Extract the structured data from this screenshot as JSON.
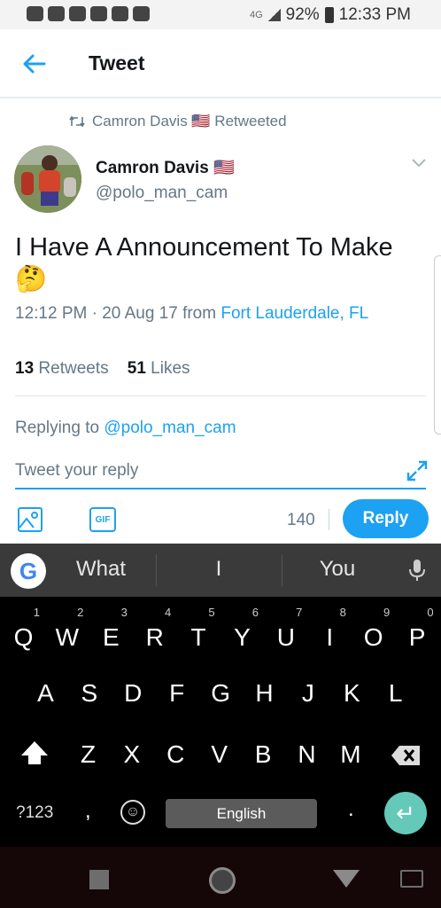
{
  "status_bar": {
    "battery": "92%",
    "time": "12:33 PM",
    "network": "4G"
  },
  "header": {
    "title": "Tweet"
  },
  "tweet": {
    "retweeted_by": "Camron Davis 🇺🇸 Retweeted",
    "author_name": "Camron Davis 🇺🇸",
    "author_handle": "@polo_man_cam",
    "text": "I Have A Announcement To Make 🤔",
    "time": "12:12 PM · 20 Aug 17",
    "from_label": "from",
    "location": "Fort Lauderdale, FL",
    "retweets_count": "13",
    "retweets_label": "Retweets",
    "likes_count": "51",
    "likes_label": "Likes"
  },
  "reply": {
    "replying_to_label": "Replying to",
    "replying_to_handle": "@polo_man_cam",
    "placeholder": "Tweet your reply",
    "gif_label": "GIF",
    "char_count": "140",
    "button_label": "Reply"
  },
  "keyboard": {
    "suggestions": [
      "What",
      "I",
      "You"
    ],
    "row1": [
      {
        "key": "Q",
        "num": "1"
      },
      {
        "key": "W",
        "num": "2"
      },
      {
        "key": "E",
        "num": "3"
      },
      {
        "key": "R",
        "num": "4"
      },
      {
        "key": "T",
        "num": "5"
      },
      {
        "key": "Y",
        "num": "6"
      },
      {
        "key": "U",
        "num": "7"
      },
      {
        "key": "I",
        "num": "8"
      },
      {
        "key": "O",
        "num": "9"
      },
      {
        "key": "P",
        "num": "0"
      }
    ],
    "row2": [
      "A",
      "S",
      "D",
      "F",
      "G",
      "H",
      "J",
      "K",
      "L"
    ],
    "row3": [
      "Z",
      "X",
      "C",
      "V",
      "B",
      "N",
      "M"
    ],
    "symbols_label": "?123",
    "comma": ",",
    "space_label": "English",
    "period": "."
  }
}
